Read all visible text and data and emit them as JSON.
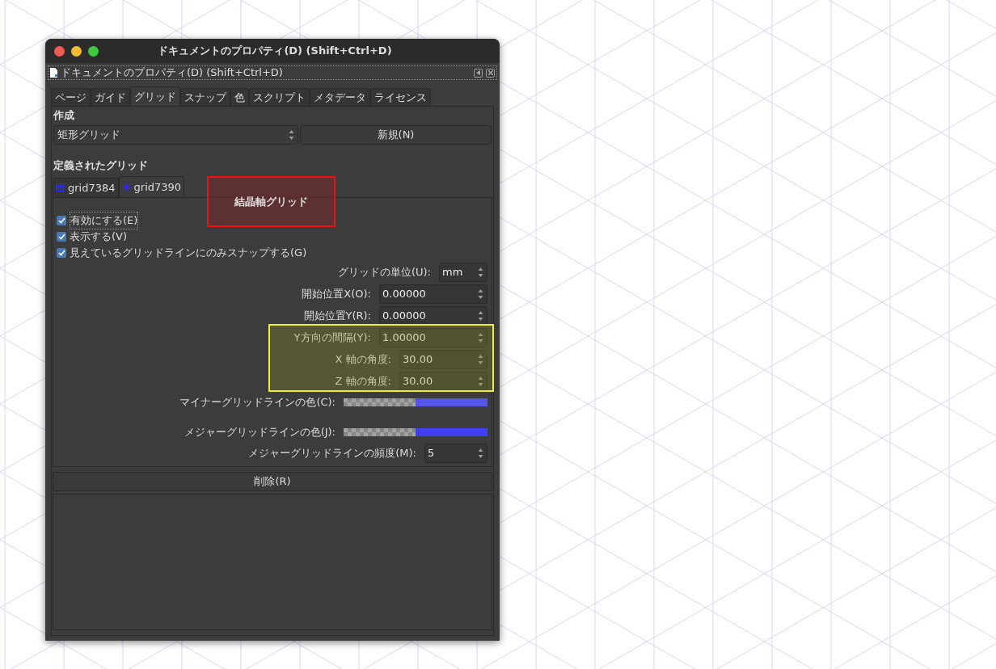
{
  "window": {
    "title": "ドキュメントのプロパティ(D) (Shift+Ctrl+D)"
  },
  "panel": {
    "title": "ドキュメントのプロパティ(D) (Shift+Ctrl+D)"
  },
  "tabs": [
    {
      "label": "ページ",
      "selected": false
    },
    {
      "label": "ガイド",
      "selected": false
    },
    {
      "label": "グリッド",
      "selected": true
    },
    {
      "label": "スナップ",
      "selected": false
    },
    {
      "label": "色",
      "selected": false
    },
    {
      "label": "スクリプト",
      "selected": false
    },
    {
      "label": "メタデータ",
      "selected": false
    },
    {
      "label": "ライセンス",
      "selected": false
    }
  ],
  "create": {
    "heading": "作成",
    "type_value": "矩形グリッド",
    "new_button": "新規(N)"
  },
  "defined": {
    "heading": "定義されたグリッド",
    "grid_tabs": [
      {
        "label": "grid7384",
        "kind": "rectangular",
        "selected": false
      },
      {
        "label": "grid7390",
        "kind": "axonometric",
        "selected": true
      }
    ],
    "checkboxes": [
      {
        "label": "有効にする(E)",
        "checked": true
      },
      {
        "label": "表示する(V)",
        "checked": true
      },
      {
        "label": "見えているグリッドラインにのみスナップする(G)",
        "checked": true
      }
    ],
    "fields": [
      {
        "kind": "unit",
        "label": "グリッドの単位(U):",
        "value": "mm"
      },
      {
        "kind": "number",
        "label": "開始位置X(O):",
        "value": "0.00000"
      },
      {
        "kind": "number",
        "label": "開始位置Y(R):",
        "value": "0.00000"
      },
      {
        "kind": "number",
        "label": "Y方向の間隔(Y):",
        "value": "1.00000"
      },
      {
        "kind": "angle",
        "label": "X 軸の角度:",
        "value": "30.00"
      },
      {
        "kind": "angle",
        "label": "Z 軸の角度:",
        "value": "30.00"
      },
      {
        "kind": "color",
        "label": "マイナーグリッドラインの色(C):",
        "color": "#5555e6"
      },
      {
        "kind": "color",
        "label": "メジャーグリッドラインの色(J):",
        "color": "#4040f0"
      },
      {
        "kind": "count",
        "label": "メジャーグリッドラインの頻度(M):",
        "value": "5"
      }
    ],
    "delete_button": "削除(R)"
  },
  "annotations": [
    {
      "kind": "label-box",
      "text": "結晶軸グリッド"
    },
    {
      "kind": "highlight"
    }
  ]
}
